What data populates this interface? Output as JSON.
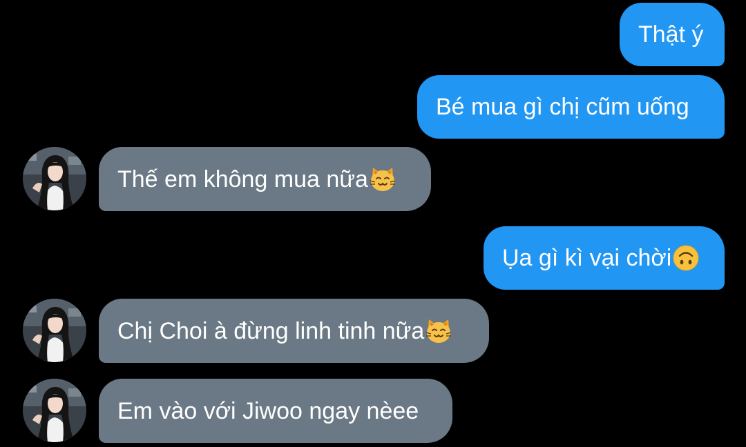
{
  "conversation": {
    "messages": [
      {
        "direction": "outgoing",
        "text": "Thật ý"
      },
      {
        "direction": "outgoing",
        "text": "Bé mua gì chị cũm uống"
      },
      {
        "direction": "incoming",
        "text": "Thế em không mua nữa",
        "emoji": "smiling-cat-emoji"
      },
      {
        "direction": "outgoing",
        "text": "Ụa gì kì vại chời",
        "emoji": "upside-down-face-emoji"
      },
      {
        "direction": "incoming",
        "text": "Chị Choi à đừng linh tinh nữa",
        "emoji": "smiling-cat-emoji"
      },
      {
        "direction": "incoming",
        "text": "Em vào với Jiwoo ngay nèee"
      }
    ]
  },
  "colors": {
    "background": "#000000",
    "outgoing_bubble": "#2196f3",
    "incoming_bubble": "#6a7985",
    "text": "#ffffff"
  }
}
